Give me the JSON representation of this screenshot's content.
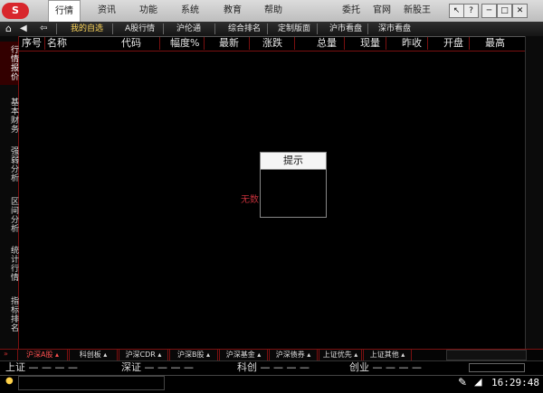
{
  "logo_text": "S",
  "menubar": {
    "items": [
      "行情",
      "资讯",
      "功能",
      "系统",
      "教育",
      "帮助"
    ],
    "right": [
      "委托",
      "官网",
      "新股王"
    ],
    "window_buttons": [
      "↖",
      "?",
      "─",
      "□",
      "✕"
    ]
  },
  "toolbar": {
    "items": [
      "我的自选",
      "A股行情",
      "沪伦通",
      "综合排名",
      "定制版面",
      "沪市看盘",
      "深市看盘"
    ]
  },
  "left_tabs": [
    "行情报价",
    "基本财务",
    "强弱分析",
    "区间分析",
    "统计行情",
    "指标排名"
  ],
  "table": {
    "headers": [
      "序号",
      "名称",
      "代码",
      "幅度%",
      "最新",
      "涨跌",
      "总量",
      "现量",
      "昨收",
      "开盘",
      "最高"
    ]
  },
  "popup": {
    "title": "提示"
  },
  "nodata_text": "无数",
  "bottom_tabs": [
    "沪深A股",
    "科创板",
    "沪深CDR",
    "沪深B股",
    "沪深基金",
    "沪深债券",
    "上证优先",
    "上证其他"
  ],
  "index_bar": [
    {
      "label": "上证",
      "values": "— — — —"
    },
    {
      "label": "深证",
      "values": "— — — —"
    },
    {
      "label": "科创",
      "values": "— — — —"
    },
    {
      "label": "创业",
      "values": "— — — —"
    }
  ],
  "status": {
    "clock": "16:29:48"
  }
}
